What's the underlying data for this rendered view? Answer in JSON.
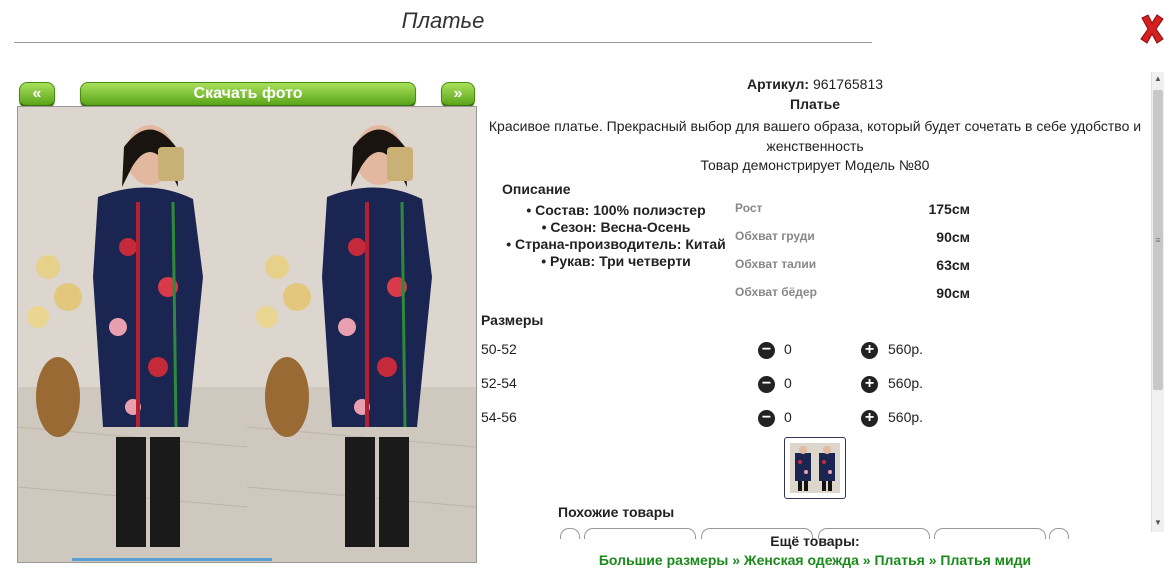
{
  "title": "Платье",
  "nav": {
    "prev": "«",
    "download": "Скачать фото",
    "next": "»"
  },
  "product": {
    "article_label": "Артикул:",
    "article_value": "961765813",
    "name": "Платье",
    "description": "Красивое платье. Прекрасный выбор для вашего образа, который будет сочетать в себе удобство и женственность",
    "model_line": "Товар демонстрирует Модель №80"
  },
  "specs": {
    "heading": "Описание",
    "items": [
      "Состав: 100% полиэстер",
      "Сезон: Весна-Осень",
      "Страна-производитель: Китай",
      "Рукав: Три четверти"
    ]
  },
  "measurements": [
    {
      "label": "Рост",
      "value": "175см"
    },
    {
      "label": "Обхват груди",
      "value": "90см"
    },
    {
      "label": "Обхват талии",
      "value": "63см"
    },
    {
      "label": "Обхват бёдер",
      "value": "90см"
    }
  ],
  "sizes": {
    "heading": "Размеры",
    "rows": [
      {
        "size": "50-52",
        "qty": "0",
        "price": "560р."
      },
      {
        "size": "52-54",
        "qty": "0",
        "price": "560р."
      },
      {
        "size": "54-56",
        "qty": "0",
        "price": "560р."
      }
    ]
  },
  "similar_heading": "Похожие товары",
  "more_heading": "Ещё товары:",
  "breadcrumbs": "Большие размеры » Женская одежда » Платья » Платья миди",
  "colors": {
    "button_green": "#5aa51a",
    "link_green": "#1a8a1a",
    "close_red": "#d42020"
  },
  "icons": [
    "close-icon",
    "minus-icon",
    "plus-icon"
  ]
}
